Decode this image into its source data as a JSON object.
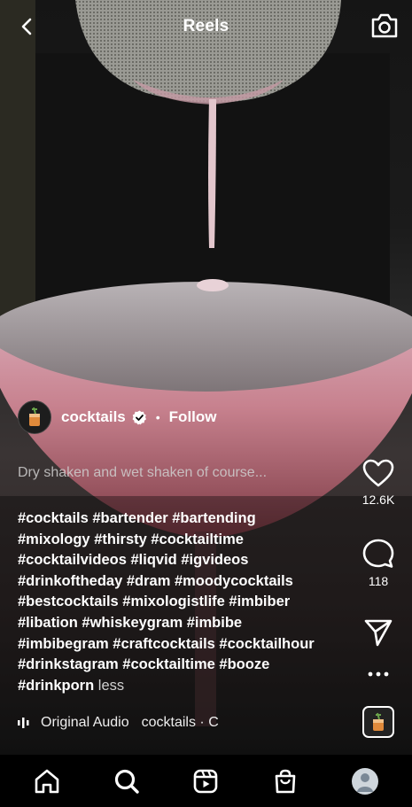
{
  "header": {
    "title": "Reels",
    "back_icon": "chevron-left-icon",
    "camera_icon": "camera-icon"
  },
  "author": {
    "username": "cocktails",
    "verified": true,
    "separator": "•",
    "follow_label": "Follow"
  },
  "caption": {
    "title": "Dry shaken and wet shaken of course...",
    "hashtag_lines": [
      "#cocktails #bartender #bartending",
      "#mixology #thirsty #cocktailtime",
      "#cocktailvideos #liqvid #igvideos",
      "#drinkoftheday #dram #moodycocktails",
      "#bestcocktails #mixologistlife #imbiber",
      "#libation #whiskeygram #imbibe",
      "#imbibegram #craftcocktails #cocktailhour",
      "#drinkstagram #cocktailtime #booze",
      "#drinkporn"
    ],
    "less_label": "less"
  },
  "audio": {
    "label": "Original Audio",
    "artist": "cocktails · C"
  },
  "actions": {
    "like_count": "12.6K",
    "comment_count": "118"
  },
  "nav": {
    "items": [
      "home-icon",
      "search-icon",
      "reels-icon",
      "shop-icon",
      "profile-avatar"
    ]
  },
  "colors": {
    "background": "#000000",
    "text": "#ffffff",
    "muted_text": "#cfcfcf",
    "drink": "#c9707a"
  }
}
